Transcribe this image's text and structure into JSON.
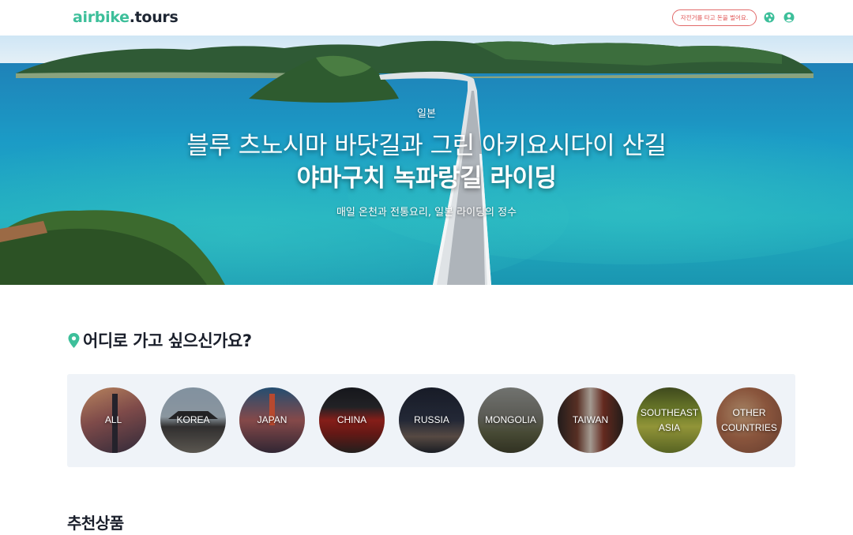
{
  "header": {
    "logo_part1": "airbike",
    "logo_part2": ".tours",
    "cta_label": "자전거를 타고 돈을 벌어요.",
    "globe_icon": "globe-icon",
    "user_icon": "user-circle-icon",
    "brand_color": "#3dbf9a",
    "cta_color": "#e05555"
  },
  "hero": {
    "country": "일본",
    "title_line1": "블루 츠노시마 바닷길과 그린 아키요시다이 산길",
    "title_line2": "야마구치 녹파랑길 라이딩",
    "subtitle": "매일 온천과 전통요리, 일본 라이딩의 정수"
  },
  "destinations": {
    "title": "어디로 가고 싶으신가요?",
    "pin_icon": "map-pin-icon",
    "items": [
      {
        "label": "ALL"
      },
      {
        "label": "KOREA"
      },
      {
        "label": "JAPAN"
      },
      {
        "label": "CHINA"
      },
      {
        "label": "RUSSIA"
      },
      {
        "label": "MONGOLIA"
      },
      {
        "label": "TAIWAN"
      },
      {
        "label": "SOUTHEAST ASIA"
      },
      {
        "label": "OTHER COUNTRIES"
      }
    ]
  },
  "recommended": {
    "title": "추천상품"
  }
}
